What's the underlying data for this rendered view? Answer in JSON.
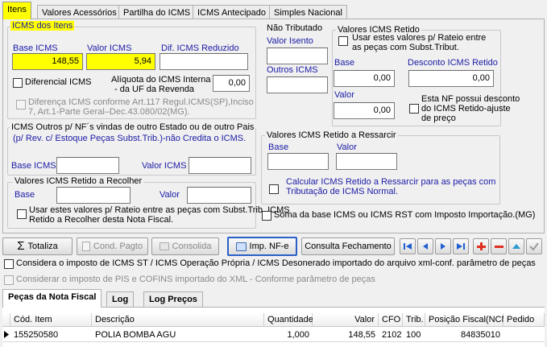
{
  "tabs": [
    {
      "label": "Itens",
      "active": true
    },
    {
      "label": "Valores Acessórios"
    },
    {
      "label": "Partilha do ICMS"
    },
    {
      "label": "ICMS Antecipado"
    },
    {
      "label": "Simples Nacional"
    }
  ],
  "icms_itens": {
    "title": "ICMS dos Itens",
    "base_label": "Base ICMS",
    "base_value": "148,55",
    "valor_label": "Valor ICMS",
    "valor_value": "5,94",
    "dif_label": "Dif. ICMS Reduzido",
    "dif_value": "",
    "diferencial_label": "Diferencial ICMS",
    "aliquota_label_1": "Alíquota do ICMS Interna",
    "aliquota_label_2": "- da UF da Revenda",
    "aliquota_value": "0,00",
    "diferenca_1": "Diferença ICMS conforme Art.117 Regul.ICMS(SP),Inciso",
    "diferenca_2": "7, Art.1-Parte Geral–Dec.43.080/02(MG)."
  },
  "icms_outros": {
    "title": "ICMS Outros p/ NF´s vindas de outro Estado ou de outro Pais",
    "subtitle": "(p/ Rev. c/ Estoque Peças Subst.Trib.)-não Credita o ICMS.",
    "base_label": "Base ICMS",
    "valor_label": "Valor ICMS"
  },
  "retido_recolher": {
    "title": "Valores ICMS Retido a Recolher",
    "base_label": "Base",
    "valor_label": "Valor",
    "check_1": "Usar estes valores p/ Rateio entre as peças com Subst.Trib. ICMS",
    "check_2": "Retido a Recolher desta Nota Fiscal."
  },
  "nao_tributado": {
    "title": "Não Tributado",
    "isento_label": "Valor Isento",
    "outros_label": "Outros ICMS"
  },
  "icms_retido": {
    "title": "Valores ICMS Retido",
    "check_1": "Usar estes valores p/ Rateio  entre",
    "check_2": "as peças com Subst.Tribut.",
    "base_label": "Base",
    "base_value": "0,00",
    "desconto_label": "Desconto ICMS Retido",
    "desconto_value": "0,00",
    "valor_label": "Valor",
    "valor_value": "0,00",
    "nf_1": "Esta NF possui desconto",
    "nf_2": "do ICMS Retido-ajuste",
    "nf_3": "de preço"
  },
  "retido_ressarcir": {
    "title": "Valores ICMS Retido a Ressarcir",
    "base_label": "Base",
    "valor_label": "Valor",
    "check_1": "Calcular ICMS Retido a  Ressarcir para as peças com",
    "check_2": "Tributação de ICMS Normal."
  },
  "soma_label": "Soma da base ICMS ou ICMS RST com Imposto Importação.(MG)",
  "toolbar": {
    "totaliza": "Totaliza",
    "cond_pagto": "Cond. Pagto",
    "consolida": "Consolida",
    "imp_nfe": "Imp. NF-e",
    "consulta": "Consulta Fechamento"
  },
  "options": {
    "considera_st": "Considera o imposto de ICMS ST / ICMS Operação Própria / ICMS Desonerado importado do arquivo xml-conf. parâmetro de peças",
    "considera_pis": "Considerar o imposto de PIS e COFINS importado do XML - Conforme parâmetro de peças"
  },
  "bottom_tabs": [
    {
      "label": "Peças da Nota Fiscal",
      "active": true
    },
    {
      "label": "Log"
    },
    {
      "label": "Log Preços"
    }
  ],
  "grid": {
    "columns": [
      "Cód. Item",
      "Descrição",
      "Quantidade",
      "Valor",
      "CFO",
      "Trib.",
      "Posição Fiscal(NCM)",
      "Pedido"
    ],
    "rows": [
      {
        "cod": "155250580",
        "descricao": "POLIA BOMBA AGU",
        "quantidade": "1,000",
        "valor": "148,55",
        "cfo": "2102",
        "trib": "100",
        "ncm": "84835010",
        "pedido": ""
      }
    ]
  },
  "colors": {
    "highlight": "#ffff00",
    "blue_label": "#1a1aa6",
    "nav_blue": "#1f5fd0",
    "nav_red": "#e03020"
  }
}
